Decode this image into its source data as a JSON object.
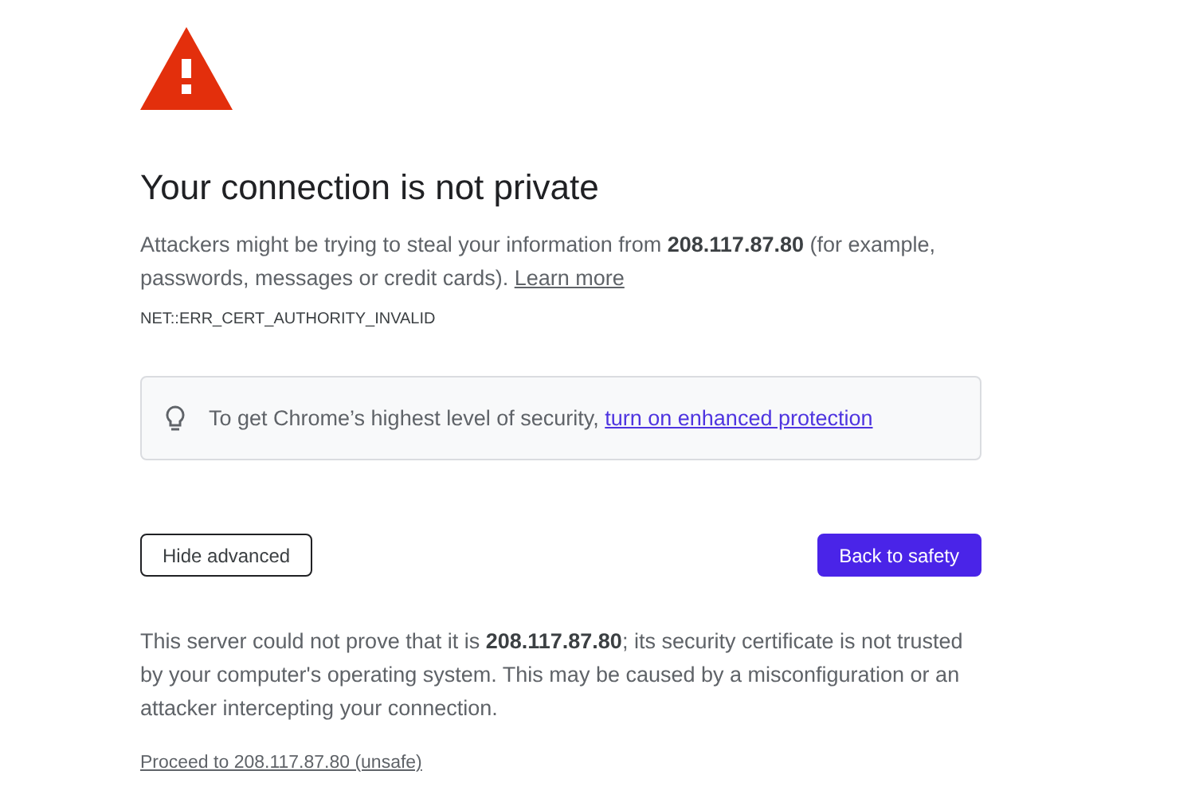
{
  "heading": "Your connection is not private",
  "intro": {
    "text": "Attackers might be trying to steal your information from **208.117.87.80** (for example, passwords, messages or credit cards).",
    "link": "Learn more"
  },
  "error_code": "NET::ERR_CERT_AUTHORITY_INVALID",
  "tip": {
    "text": "To get Chrome’s highest level of security,",
    "link": "turn on enhanced protection"
  },
  "buttons": [
    {
      "label": "Hide advanced",
      "kind": "secondary"
    },
    {
      "label": "Back to safety",
      "kind": "primary"
    }
  ],
  "details": "This server could not prove that it is **208.117.87.80**; its security certificate is not trusted by your computer's operating system. This may be caused by a misconfiguration or an attacker intercepting your connection.",
  "proceed_link": "Proceed to 208.117.87.80 (unsafe)"
}
